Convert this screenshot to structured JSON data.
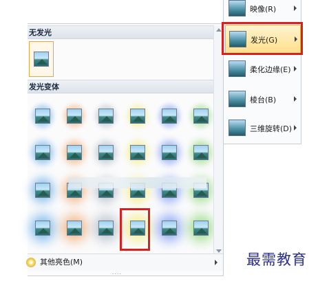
{
  "gallery": {
    "no_glow_header": "无发光",
    "variations_header": "发光变体",
    "more_colors_label": "其他亮色(M)",
    "grip_dots": "....",
    "glow_colors": [
      "#5aa7e6",
      "#f0a060",
      "#a9b4c0",
      "#f2ea6e",
      "#6e8ff0",
      "#86d46e"
    ]
  },
  "menu": {
    "items": [
      {
        "label": "映像(R)",
        "icon": "reflection-icon"
      },
      {
        "label": "发光(G)",
        "icon": "glow-icon"
      },
      {
        "label": "柔化边缘(E)",
        "icon": "soft-edges-icon"
      },
      {
        "label": "棱台(B)",
        "icon": "bevel-icon"
      },
      {
        "label": "三维旋转(D)",
        "icon": "3d-rotation-icon"
      }
    ]
  },
  "watermark": "最需教育",
  "colors": {
    "highlight": "#d9201f",
    "hover_fill": "#ffdf8a"
  }
}
